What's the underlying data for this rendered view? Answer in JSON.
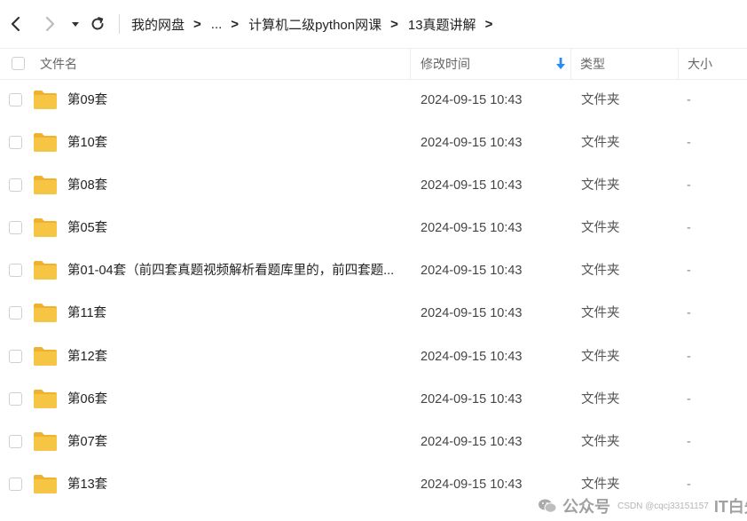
{
  "nav": {
    "back_icon": "chevron-left-icon",
    "forward_icon": "chevron-right-icon",
    "dropdown_icon": "caret-down-icon",
    "refresh_icon": "refresh-icon",
    "breadcrumb": [
      "我的网盘",
      "...",
      "计算机二级python网课",
      "13真题讲解"
    ],
    "separator": ">"
  },
  "table": {
    "columns": {
      "name": "文件名",
      "mtime": "修改时间",
      "type": "类型",
      "size": "大小"
    },
    "sort_icon": "arrow-down-icon",
    "rows": [
      {
        "name": "第09套",
        "mtime": "2024-09-15 10:43",
        "type": "文件夹",
        "size": "-"
      },
      {
        "name": "第10套",
        "mtime": "2024-09-15 10:43",
        "type": "文件夹",
        "size": "-"
      },
      {
        "name": "第08套",
        "mtime": "2024-09-15 10:43",
        "type": "文件夹",
        "size": "-"
      },
      {
        "name": "第05套",
        "mtime": "2024-09-15 10:43",
        "type": "文件夹",
        "size": "-"
      },
      {
        "name": "第01-04套（前四套真题视频解析看题库里的，前四套题...",
        "mtime": "2024-09-15 10:43",
        "type": "文件夹",
        "size": "-"
      },
      {
        "name": "第11套",
        "mtime": "2024-09-15 10:43",
        "type": "文件夹",
        "size": "-"
      },
      {
        "name": "第12套",
        "mtime": "2024-09-15 10:43",
        "type": "文件夹",
        "size": "-"
      },
      {
        "name": "第06套",
        "mtime": "2024-09-15 10:43",
        "type": "文件夹",
        "size": "-"
      },
      {
        "name": "第07套",
        "mtime": "2024-09-15 10:43",
        "type": "文件夹",
        "size": "-"
      },
      {
        "name": "第13套",
        "mtime": "2024-09-15 10:43",
        "type": "文件夹",
        "size": "-"
      }
    ]
  },
  "watermark": {
    "icon": "wechat-icon",
    "label": "公众号",
    "small": "CSDN @cqcj33151157",
    "brand": "IT白先生"
  },
  "colors": {
    "folder": "#f7c544",
    "folder_dark": "#eeb22f",
    "sort_arrow": "#2a8af6",
    "divider": "#eeeeee"
  }
}
